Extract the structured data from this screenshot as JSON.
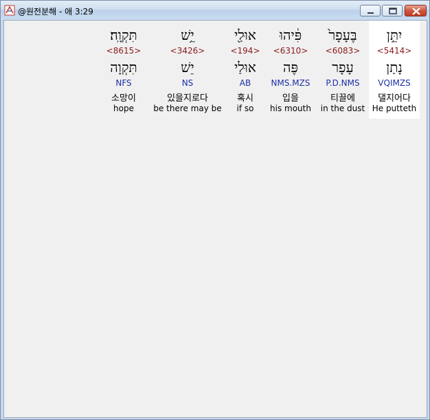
{
  "window": {
    "title": "@원전분해 - 애 3:29",
    "buttons": {
      "minimize": "minimize-icon",
      "maximize": "maximize-icon",
      "close": "close-icon"
    }
  },
  "columns": [
    {
      "hebrew": "יִתֵּ֣ן",
      "strong": "<5414>",
      "lemma": "נָתַן",
      "morph": "VQIMZS",
      "korean": "댈지어다",
      "english": "He putteth"
    },
    {
      "hebrew": "בֶּעָפָר֙",
      "strong": "<6083>",
      "lemma": "עָפָר",
      "morph": "P.D.NMS",
      "korean": "티끌에",
      "english": "in the dust"
    },
    {
      "hebrew": "פִּ֔יהוּ",
      "strong": "<6310>",
      "lemma": "פֶּה",
      "morph": "NMS.MZS",
      "korean": "입을",
      "english": "his mouth"
    },
    {
      "hebrew": "אוּלַ֖י",
      "strong": "<194>",
      "lemma": "אוּלַי",
      "morph": "AB",
      "korean": "혹시",
      "english": "if so"
    },
    {
      "hebrew": "יֵ֥שׁ",
      "strong": "<3426>",
      "lemma": "יֵשׁ",
      "morph": "NS",
      "korean": "있을지로다",
      "english": "be there may be"
    },
    {
      "hebrew": "תִּקְוָֽה׃",
      "strong": "<8615>",
      "lemma": "תִּקְוָה",
      "morph": "NFS",
      "korean": "소망이",
      "english": "hope"
    }
  ]
}
